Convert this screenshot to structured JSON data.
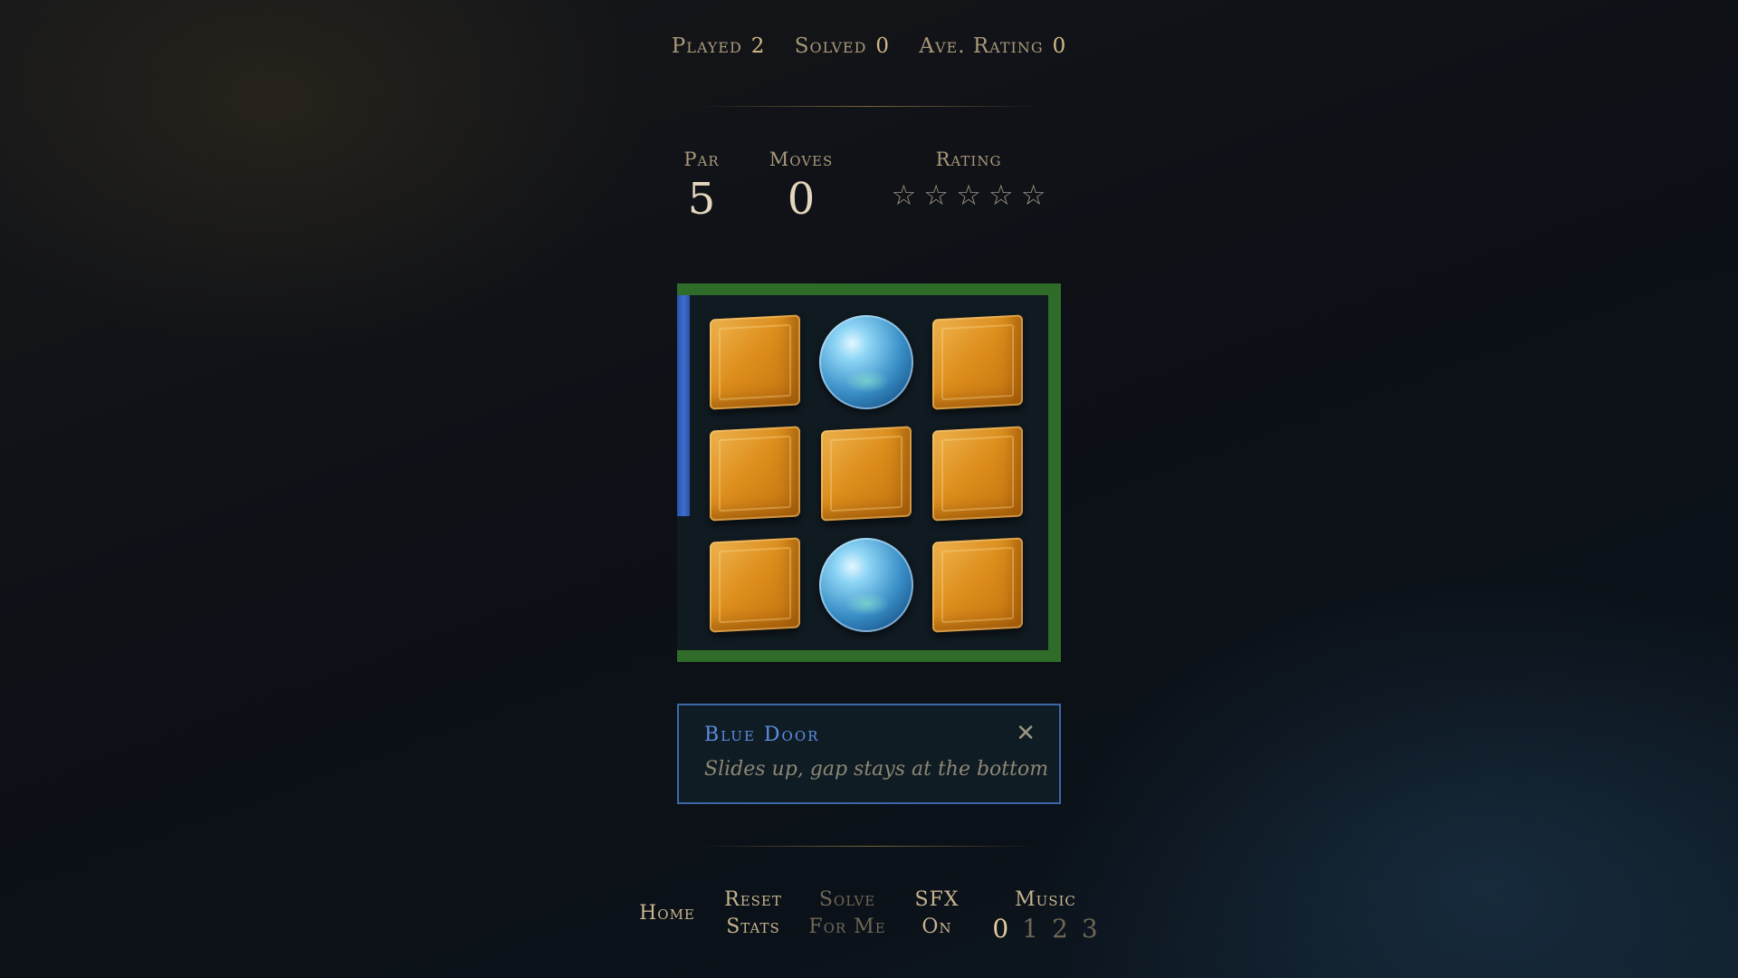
{
  "top_stats": {
    "played_label": "Played",
    "played_value": "2",
    "solved_label": "Solved",
    "solved_value": "0",
    "avg_rating_label": "Ave. Rating",
    "avg_rating_value": "0"
  },
  "header": {
    "par_label": "Par",
    "par_value": "5",
    "moves_label": "Moves",
    "moves_value": "0",
    "rating_label": "Rating",
    "rating_stars_filled": 0,
    "rating_stars_total": 5
  },
  "board": {
    "rows": 3,
    "cols": 3,
    "tiles": [
      [
        "cube",
        "orb",
        "cube"
      ],
      [
        "cube",
        "cube",
        "cube"
      ],
      [
        "cube",
        "orb",
        "cube"
      ]
    ],
    "frame_color": "#2f6c2a",
    "door_color": "#3e6fcc"
  },
  "info": {
    "title": "Blue Door",
    "text": "Slides up, gap stays at the bottom"
  },
  "menu": {
    "home": "Home",
    "reset_line1": "Reset",
    "reset_line2": "Stats",
    "solve_line1": "Solve",
    "solve_line2": "For Me",
    "sfx_line1": "SFX",
    "sfx_line2": "On",
    "music_label": "Music",
    "music_options": [
      "0",
      "1",
      "2",
      "3"
    ],
    "music_selected": "0"
  },
  "colors": {
    "accent": "#c9b68f",
    "blue": "#5d8de2",
    "green_frame": "#2f6c2a"
  }
}
